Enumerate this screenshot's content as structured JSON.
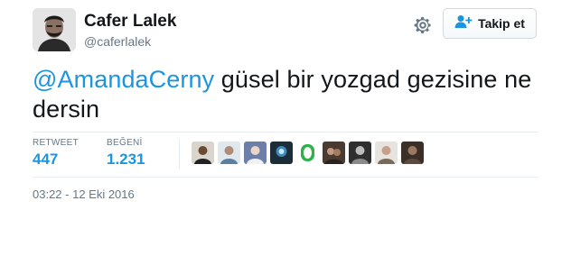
{
  "author": {
    "name": "Cafer Lalek",
    "handle": "@caferlalek"
  },
  "actions": {
    "follow_label": "Takip et",
    "settings_icon": "gear-icon",
    "follow_icon": "add-user-icon"
  },
  "tweet": {
    "mention": "@AmandaCerny",
    "text": " güsel bir yozgad gezisine ne dersin"
  },
  "stats": {
    "retweet_label": "RETWEET",
    "retweet_count": "447",
    "like_label": "BEĞENİ",
    "like_count": "1.231"
  },
  "likers_count_shown": 9,
  "timestamp": "03:22 - 12 Eki 2016",
  "colors": {
    "link": "#1b95e0",
    "text": "#14171a",
    "muted": "#657786",
    "border": "#e6ecf0"
  }
}
